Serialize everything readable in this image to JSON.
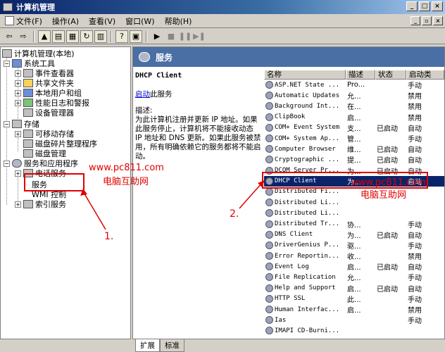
{
  "window": {
    "title": "计算机管理"
  },
  "menu": {
    "items": [
      "文件(F)",
      "操作(A)",
      "查看(V)",
      "窗口(W)",
      "帮助(H)"
    ]
  },
  "tree": {
    "root": "计算机管理(本地)",
    "system_tools": "系统工具",
    "event_viewer": "事件查看器",
    "shared_folders": "共享文件夹",
    "local_users": "本地用户和组",
    "perf_logs": "性能日志和警报",
    "device_manager": "设备管理器",
    "storage": "存储",
    "removable": "可移动存储",
    "defrag": "磁盘碎片整理程序",
    "disk_mgmt": "磁盘管理",
    "services_apps": "服务和应用程序",
    "telephony": "电话服务",
    "services": "服务",
    "wmi": "WMI 控制",
    "indexing": "索引服务"
  },
  "right_header": {
    "title": "服务"
  },
  "description": {
    "service_name": "DHCP Client",
    "start_link": "启动",
    "start_suffix": "此服务",
    "desc_label": "描述:",
    "desc_text": "为此计算机注册并更新 IP 地址。如果此服务停止，计算机将不能接收动态 IP 地址和 DNS 更新。如果此服务被禁用，所有明确依赖它的服务都将不能启动。"
  },
  "list": {
    "headers": [
      "名称",
      "描述",
      "状态",
      "启动类"
    ],
    "rows": [
      [
        "ASP.NET State ...",
        "Pro...",
        "",
        "手动"
      ],
      [
        "Automatic Updates",
        "允...",
        "",
        "禁用"
      ],
      [
        "Background Int...",
        "在...",
        "",
        "禁用"
      ],
      [
        "ClipBook",
        "启...",
        "",
        "禁用"
      ],
      [
        "COM+ Event System",
        "支...",
        "已启动",
        "自动"
      ],
      [
        "COM+ System Ap...",
        "管...",
        "",
        "手动"
      ],
      [
        "Computer Browser",
        "维...",
        "已启动",
        "自动"
      ],
      [
        "Cryptographic ...",
        "提...",
        "已启动",
        "自动"
      ],
      [
        "DCOM Server Pr...",
        "为...",
        "已启动",
        "自动"
      ],
      [
        "DHCP Client",
        "为...",
        "",
        "自动"
      ],
      [
        "Distributed Fi...",
        "",
        "",
        ""
      ],
      [
        "Distributed Li...",
        "",
        "",
        ""
      ],
      [
        "Distributed Li...",
        "",
        "",
        ""
      ],
      [
        "Distributed Tr...",
        "协...",
        "",
        "手动"
      ],
      [
        "DNS Client",
        "为...",
        "已启动",
        "自动"
      ],
      [
        "DriverGenius P...",
        "驱...",
        "",
        "手动"
      ],
      [
        "Error Reportin...",
        "收...",
        "",
        "禁用"
      ],
      [
        "Event Log",
        "启...",
        "已启动",
        "自动"
      ],
      [
        "File Replication",
        "允...",
        "",
        "手动"
      ],
      [
        "Help and Support",
        "启...",
        "已启动",
        "自动"
      ],
      [
        "HTTP SSL",
        "此...",
        "",
        "手动"
      ],
      [
        "Human Interfac...",
        "启...",
        "",
        "禁用"
      ],
      [
        "Ias",
        "",
        "",
        "手动"
      ],
      [
        "IMAPI CD-Burni...",
        "",
        "",
        ""
      ]
    ]
  },
  "tabs": [
    "扩展",
    "标准"
  ],
  "annotations": {
    "step1": "1.",
    "step2": "2.",
    "watermark_url": "www.pc811.com",
    "watermark_name": "电脑互助网"
  }
}
